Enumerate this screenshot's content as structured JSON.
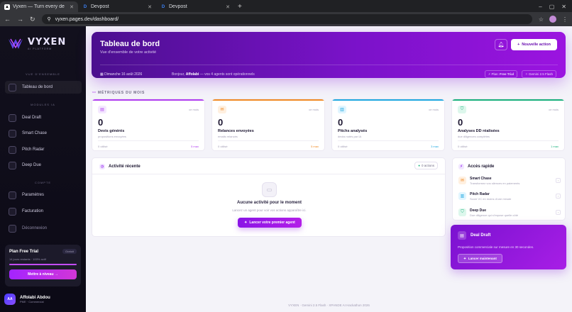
{
  "browser": {
    "tabs": [
      {
        "label": "Vyxen — Turn every de",
        "icon": "vyxen-favicon",
        "active": true
      },
      {
        "label": "Devpost",
        "icon": "devpost-favicon",
        "active": false
      },
      {
        "label": "Devpost",
        "icon": "devpost-favicon",
        "active": false
      }
    ],
    "url": "vyxen.pages.dev/dashboard/"
  },
  "sidebar": {
    "brand": "VYXEN",
    "brand_sub": "AI PLATFORM",
    "sections": [
      "VUE D'ENSEMBLE",
      "MODULES IA",
      "COMPTE"
    ],
    "items": [
      {
        "label": "Tableau de bord",
        "icon": "grid-icon"
      },
      {
        "label": "Deal Draft",
        "icon": "document-icon"
      },
      {
        "label": "Smart Chase",
        "icon": "mail-icon"
      },
      {
        "label": "Pitch Radar",
        "icon": "chart-icon"
      },
      {
        "label": "Deep Due",
        "icon": "shield-icon"
      },
      {
        "label": "Paramètres",
        "icon": "gear-icon"
      },
      {
        "label": "Facturation",
        "icon": "card-icon"
      },
      {
        "label": "Déconnexion",
        "icon": "logout-icon"
      }
    ],
    "plan": {
      "title": "Plan Free Trial",
      "badge": "Gratuit",
      "sub": "14 jours restants · 100% actif",
      "progress": 1.0,
      "cta": "Mettre à niveau →"
    },
    "user": {
      "initials": "AA",
      "name": "Affolabi Abdou",
      "role": "PME · Commercial"
    }
  },
  "hero": {
    "title": "Tableau de bord",
    "subtitle": "Vue d'ensemble de votre activité",
    "new_action": "Nouvelle action",
    "date": "Dimanche 16 août 2026",
    "greeting_prefix": "Bonjour,",
    "greeting_name": "Affolabi",
    "greeting_suffix": "— vos 4 agents sont opérationnels",
    "plan_pill_prefix": "Plan",
    "plan_pill_name": "Free Trial",
    "model_pill": "Gemini 2.5 Flash"
  },
  "metrics_title": "MÉTRIQUES DU MOIS",
  "metrics": [
    {
      "period": "ce mois",
      "value": "0",
      "title": "Devis générés",
      "sub": "propositions envoyées",
      "foot_left": "0 utilisé",
      "foot_right": "5 max",
      "color": "#b03ef0",
      "bg": "#f4e8ff",
      "icon": "document-icon"
    },
    {
      "period": "ce mois",
      "value": "0",
      "title": "Relances envoyées",
      "sub": "emails relancés",
      "foot_left": "0 utilisé",
      "foot_right": "5 max",
      "color": "#f08a24",
      "bg": "#fff0e0",
      "icon": "mail-icon"
    },
    {
      "period": "ce mois",
      "value": "0",
      "title": "Pitchs analysés",
      "sub": "decks notés par IA",
      "foot_left": "0 utilisé",
      "foot_right": "3 max",
      "color": "#1fa8e0",
      "bg": "#e0f5ff",
      "icon": "chart-icon"
    },
    {
      "period": "ce mois",
      "value": "0",
      "title": "Analyses DD réalisées",
      "sub": "due diligences complètes",
      "foot_left": "0 utilisé",
      "foot_right": "1 max",
      "color": "#18b07c",
      "bg": "#ddf7ec",
      "icon": "shield-icon"
    }
  ],
  "activity": {
    "title": "Activité récente",
    "count": "0 actions",
    "empty_title": "Aucune activité pour le moment",
    "empty_sub": "Lancez un agent pour voir vos actions apparaître ici.",
    "cta": "Lancer votre premier agent"
  },
  "quick": {
    "title": "Accès rapide",
    "items": [
      {
        "name": "Smart Chase",
        "sub": "Transformez vos silences en paiements",
        "color": "#f08a24",
        "bg": "#fff0e0",
        "icon": "mail-icon"
      },
      {
        "name": "Pitch Radar",
        "sub": "Score VC en moins d'une minute",
        "color": "#1fa8e0",
        "bg": "#e0f5ff",
        "icon": "chart-icon"
      },
      {
        "name": "Deep Due",
        "sub": "Due diligence qui s'impose quelle côté",
        "color": "#18b07c",
        "bg": "#ddf7ec",
        "icon": "shield-icon"
      }
    ]
  },
  "deal": {
    "title": "Deal Draft",
    "sub": "Proposition commerciale sur mesure en 30 secondes.",
    "cta": "Lancer maintenant"
  },
  "footer": "VYXEN · Gemini 2.5 Flash · XPANDE AI Hackathon 2026"
}
